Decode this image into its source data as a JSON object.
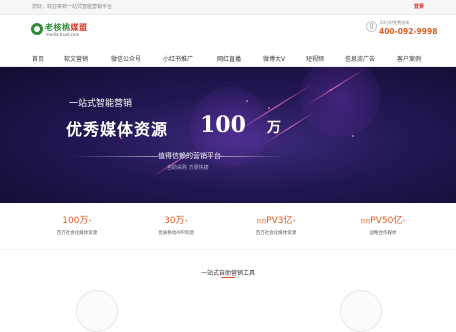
{
  "topbar": {
    "welcome": "您好，欢迎来到一站式智能营销平台",
    "login": "登录"
  },
  "header": {
    "logo_name_main": "老核桃",
    "logo_name_hot": "媒盟",
    "logo_url": "media.truet.com",
    "phone_label": "24小时免费咨询",
    "phone_number": "400-092-9998"
  },
  "nav": {
    "items": [
      "首页",
      "软文营销",
      "微信公众号",
      "小红书推广",
      "网红直播",
      "微博大V",
      "短视频",
      "信息流广告",
      "客户案例"
    ]
  },
  "hero": {
    "tagline": "一站式智能营销",
    "headline": "优秀媒体资源",
    "count": "100",
    "unit": "万",
    "sub": "值得信赖的营销平台",
    "small": "自助采购  方便快捷"
  },
  "stats": [
    {
      "prefix": "",
      "value": "100万",
      "plus": "+",
      "label": "百万社会化媒体资源"
    },
    {
      "prefix": "",
      "value": "30万",
      "plus": "+",
      "label": "优质移动APP资源"
    },
    {
      "prefix": "日均",
      "value": "PV3亿",
      "plus": "+",
      "label": "百万社会化媒体资源"
    },
    {
      "prefix": "日均",
      "value": "PV50亿",
      "plus": "+",
      "label": "战略合作媒体"
    }
  ],
  "section": {
    "title": "一站式自助营销工具"
  },
  "colors": {
    "accent": "#e25a1c",
    "brand_green": "#2f8a3a",
    "login_red": "#d9332a",
    "hero_bg": "#231753"
  }
}
